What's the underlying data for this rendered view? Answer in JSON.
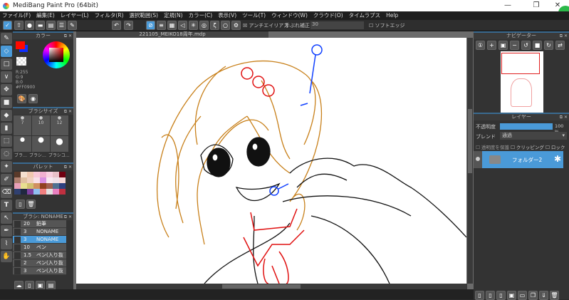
{
  "window": {
    "title": "MediBang Paint Pro (64bit)",
    "min": "—",
    "max": "❐",
    "close": "✕"
  },
  "menu": [
    "ファイル(F)",
    "編集(E)",
    "レイヤー(L)",
    "フィルタ(R)",
    "選択範囲(S)",
    "定規(N)",
    "カラー(C)",
    "表示(V)",
    "ツール(T)",
    "ウィンドウ(W)",
    "クラウド(O)",
    "タイムラプス",
    "Help"
  ],
  "toolbar": {
    "antialias_label": "アンチエイリアス",
    "stabilizer_label": "手ぶれ補正",
    "stabilizer_value": "30",
    "soft_edge_label": "ソフトエッジ"
  },
  "document": {
    "tab": "221105_MEIKO18周年.mdp"
  },
  "color_panel": {
    "title": "カラー",
    "r": "R:255",
    "g": "G:9",
    "b": "B:0",
    "hex": "#FF0900",
    "fg": "#ff0900",
    "bg": "#1030ff"
  },
  "brush_size_panel": {
    "title": "ブラシサイズ",
    "sizes": [
      "7",
      "10",
      "12"
    ],
    "tabs": [
      "ブラ…",
      "ブラシ…",
      "ブラシコ…"
    ]
  },
  "palette_panel": {
    "title": "パレット",
    "colors": [
      "#5a3a2a",
      "#f5e0d0",
      "#f0c8b0",
      "#f8c8d8",
      "#f0b0d0",
      "#f8d0e0",
      "#e8c0c8",
      "#700010",
      "#b08070",
      "#e0c0a0",
      "#f0d0c0",
      "#f8e0e8",
      "#d890e0",
      "#f8e8f0",
      "#f0e0e8",
      "#f8d8d8",
      "#e8a0b8",
      "#e8e090",
      "#d0c070",
      "#d09060",
      "#904020",
      "#a06050",
      "#507090",
      "#304080",
      "#304070",
      "#202840",
      "#8040a0",
      "#90c0f0",
      "#f08080",
      "#e0e0e0",
      "#e880c0",
      "#c03040"
    ]
  },
  "brush_panel": {
    "title": "ブラシ: NONAME",
    "items": [
      {
        "size": "20",
        "name": "鉛筆"
      },
      {
        "size": "3",
        "name": "NONAME"
      },
      {
        "size": "3",
        "name": "NONAME",
        "selected": true
      },
      {
        "size": "10",
        "name": "ペン"
      },
      {
        "size": "1.5",
        "name": "ペン(入り抜"
      },
      {
        "size": "2",
        "name": "ペン(入り抜"
      },
      {
        "size": "3",
        "name": "ペン(入り抜"
      }
    ]
  },
  "navigator": {
    "title": "ナビゲーター"
  },
  "layer_panel": {
    "title": "レイヤー",
    "opacity_label": "不透明度",
    "opacity_value": "100 %",
    "opacity": 100,
    "blend_label": "ブレンド",
    "blend_value": "通過",
    "protect_label": "透明度を保護",
    "clipping_label": "クリッピング",
    "lock_label": "ロック",
    "layers": [
      {
        "name": "フォルダー2"
      }
    ]
  }
}
